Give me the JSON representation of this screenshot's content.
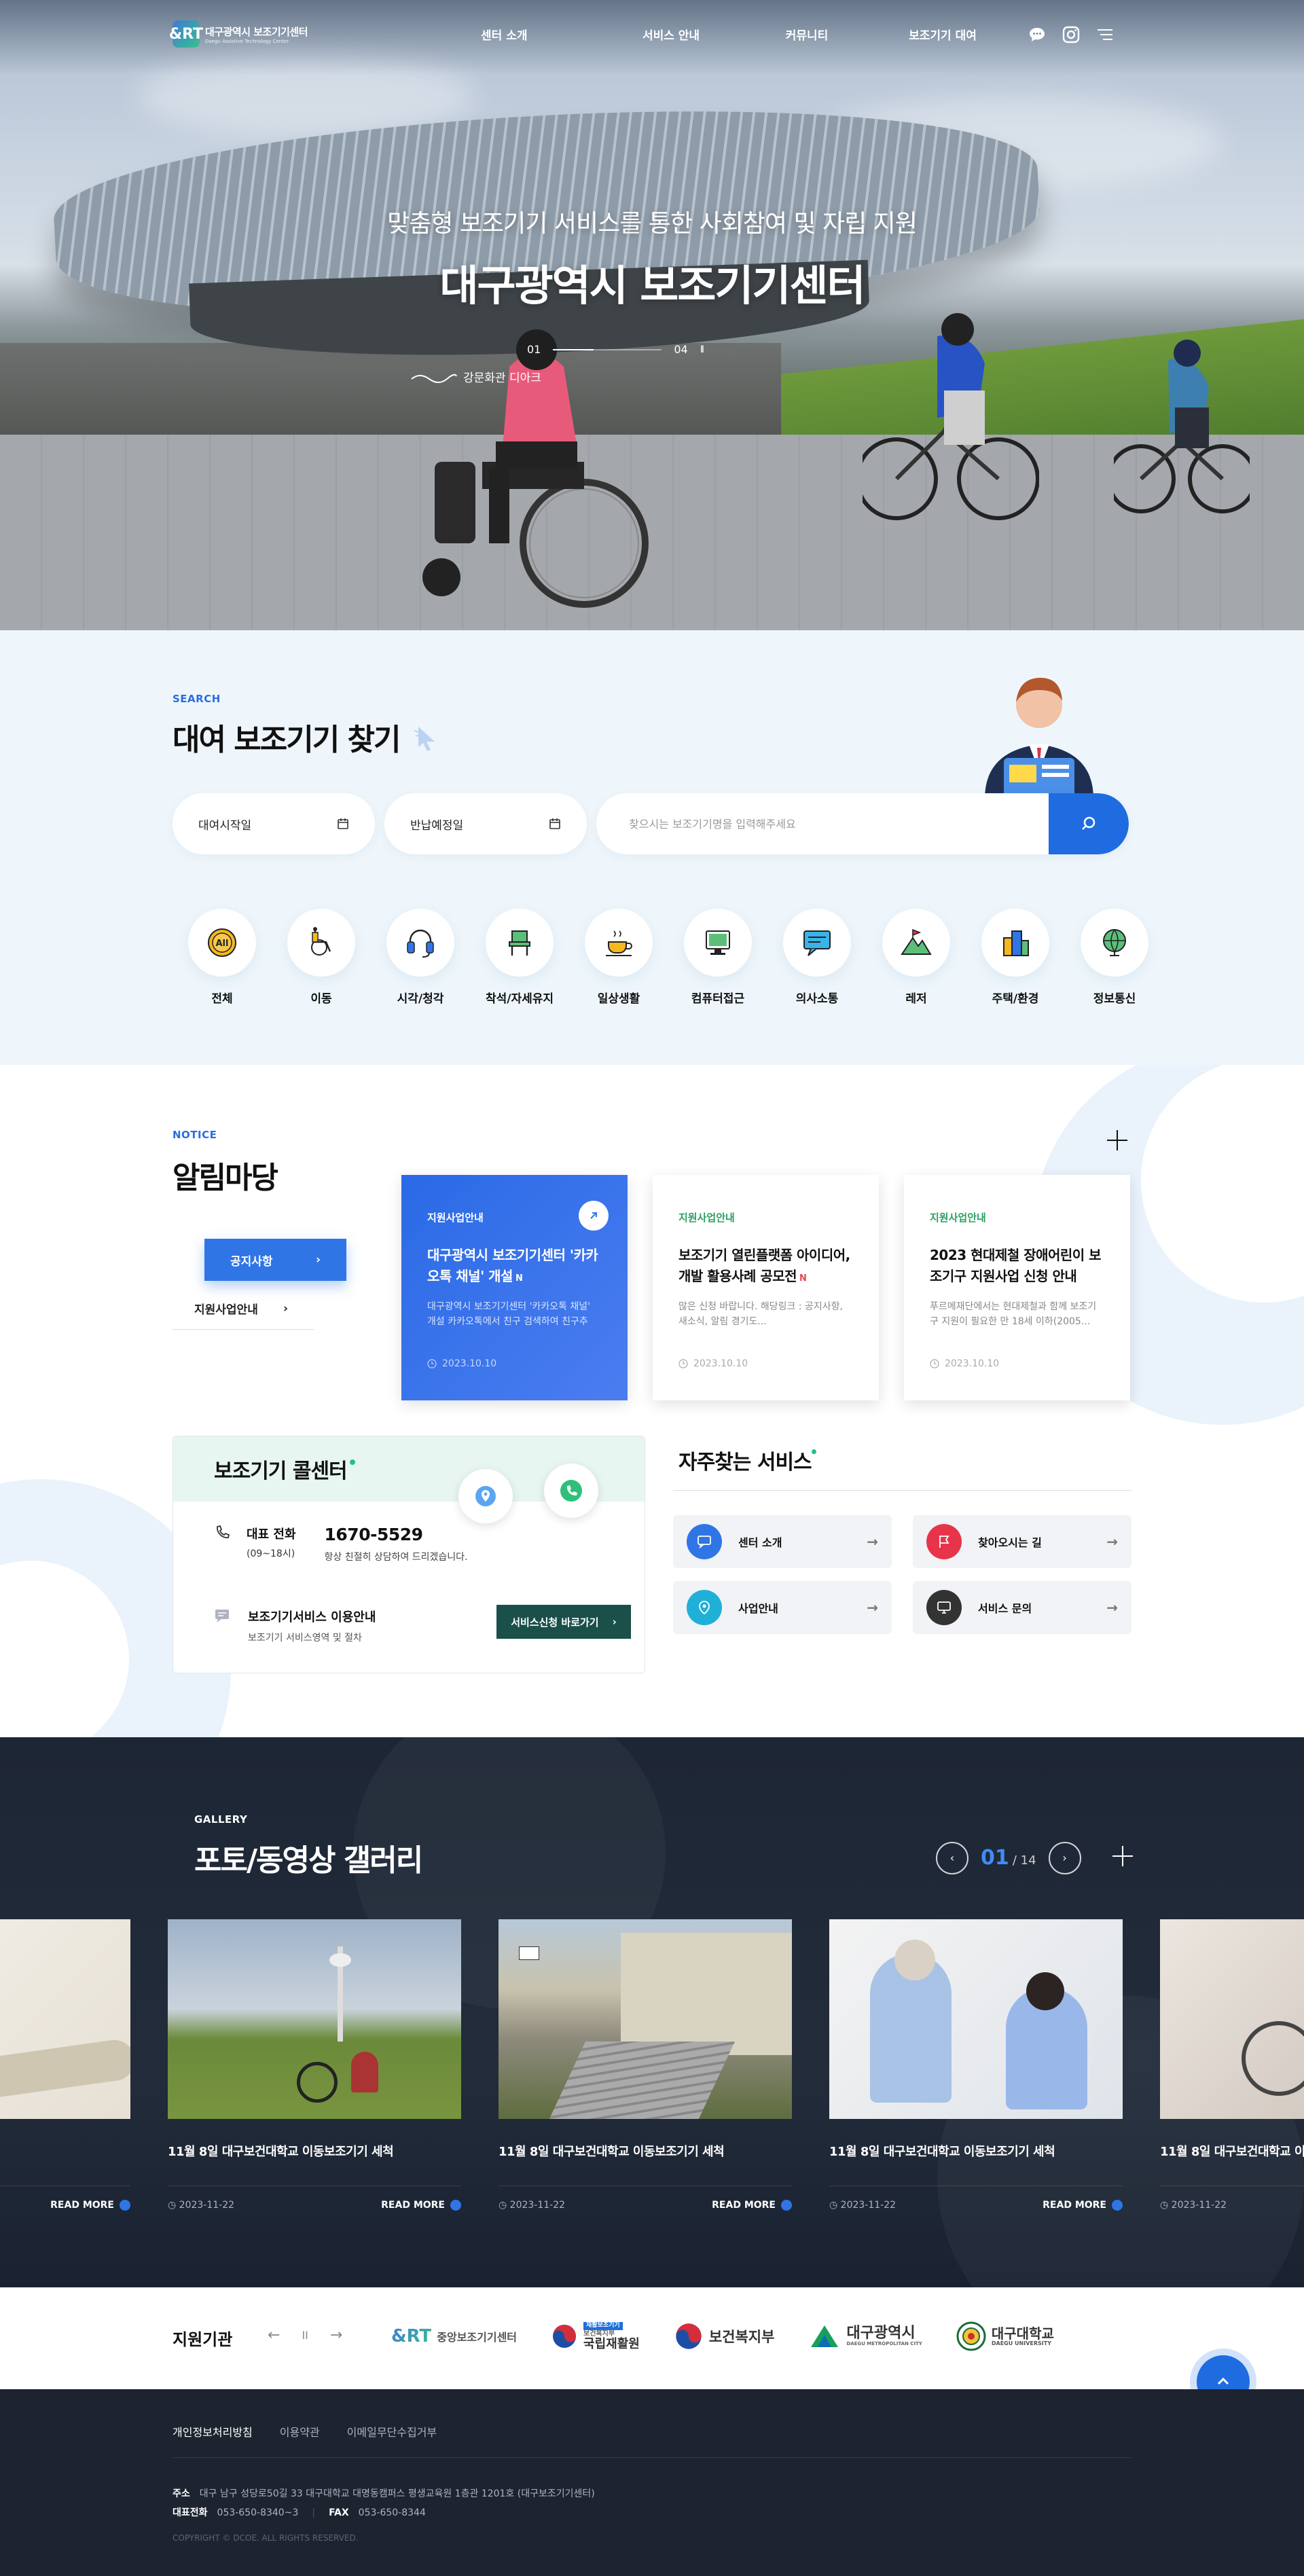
{
  "header": {
    "logo_mark": "&RT",
    "logo_ko": "대구광역시 보조기기센터",
    "logo_en": "Daegu Assistive Technology Center",
    "nav": [
      "센터 소개",
      "서비스 안내",
      "커뮤니티",
      "보조기기 대여"
    ],
    "icons": [
      "chat-icon",
      "instagram-icon",
      "menu-icon"
    ]
  },
  "hero": {
    "subtitle": "맞춤형 보조기기 서비스를 통한 사회참여 및 자립 지원",
    "title": "대구광역시 보조기기센터",
    "slide_current": "01",
    "slide_total": "04",
    "pause_label": "II",
    "caption": "강문화관 디아크"
  },
  "search": {
    "eyebrow": "SEARCH",
    "title": "대여 보조기기 찾기",
    "start_date_label": "대여시작일",
    "end_date_label": "반납예정일",
    "placeholder": "찾으시는 보조기기명을 입력해주세요",
    "categories": [
      "전체",
      "이동",
      "시각/청각",
      "착석/자세유지",
      "일상생활",
      "컴퓨터접근",
      "의사소통",
      "레저",
      "주택/환경",
      "정보통신"
    ],
    "all_icon_text": "All"
  },
  "notice": {
    "eyebrow": "NOTICE",
    "title": "알림마당",
    "tabs": [
      "공지사항",
      "지원사업안내"
    ],
    "cards": [
      {
        "tag": "지원사업안내",
        "title": "대구광역시 보조기기센터 '카카오톡 채널' 개설",
        "new": "N",
        "desc": "대구광역시 보조기기센터 '카카오톡 채널' 개설 카카오톡에서 친구 검색하여 친구추가...",
        "date": "2023.10.10"
      },
      {
        "tag": "지원사업안내",
        "title": "보조기기 열린플랫폼 아이디어, 개발 활용사례 공모전",
        "new": "N",
        "desc": "많은 신청 바랍니다. 해당링크 : 공지사항, 새소식, 알림 경기도...",
        "date": "2023.10.10"
      },
      {
        "tag": "지원사업안내",
        "title": "2023 현대제철 장애어린이 보조기구 지원사업 신청 안내",
        "new": "",
        "desc": "푸르메재단에서는 현대제철과 함께 보조기구 지원이 필요한 만 18세 이하(2005...",
        "date": "2023.10.10"
      }
    ]
  },
  "call_center": {
    "title": "보조기기 콜센터",
    "phone_label": "대표 전화",
    "hours": "(09~18시)",
    "phone": "1670-5529",
    "phone_note": "항상 친절히 상담하여 드리겠습니다.",
    "guide_label": "보조기기서비스 이용안내",
    "guide_sub": "보조기기 서비스영역 및 절차",
    "guide_button": "서비스신청 바로가기"
  },
  "favorites": {
    "title": "자주찾는 서비스",
    "items": [
      {
        "label": "센터 소개",
        "icon": "chat-icon",
        "color": "#2f75e6"
      },
      {
        "label": "찾아오시는 길",
        "icon": "flag-icon",
        "color": "#e8344a"
      },
      {
        "label": "사업안내",
        "icon": "pin-icon",
        "color": "#1fb0d8"
      },
      {
        "label": "서비스 문의",
        "icon": "monitor-icon",
        "color": "#333333"
      }
    ]
  },
  "gallery": {
    "eyebrow": "GALLERY",
    "title": "포토/동영상 갤러리",
    "current": "01",
    "total": "/ 14",
    "items": [
      {
        "caption": "",
        "date": "",
        "read_more": "READ MORE"
      },
      {
        "caption": "11월 8일 대구보건대학교 이동보조기기 세척",
        "date": "2023-11-22",
        "read_more": "READ MORE"
      },
      {
        "caption": "11월 8일 대구보건대학교 이동보조기기 세척",
        "date": "2023-11-22",
        "read_more": "READ MORE"
      },
      {
        "caption": "11월 8일 대구보건대학교 이동보조기기 세척",
        "date": "2023-11-22",
        "read_more": "READ MORE"
      },
      {
        "caption": "11월 8일 대구보건대학교 이동보조기기 세척",
        "date": "2023-11-22",
        "read_more": ""
      }
    ]
  },
  "partners": {
    "title": "지원기관",
    "logos": [
      "중앙보조기기센터",
      "국립재활원",
      "보건복지부",
      "대구광역시",
      "대구대학교"
    ],
    "logo_subs": [
      "",
      "보건복지부",
      "",
      "DAEGU METROPOLITAN CITY",
      "DAEGU UNIVERSITY"
    ],
    "rehab_badge": "재활보조기기"
  },
  "footer": {
    "links": [
      "개인정보처리방침",
      "이용약관",
      "이메일무단수집거부"
    ],
    "address_label": "주소",
    "address": "대구 남구 성당로50길 33 대구대학교 대명동캠퍼스 평생교육원 1층관 1201호 (대구보조기기센터)",
    "phone_label": "대표전화",
    "phone": "053-650-8340~3",
    "fax_label": "FAX",
    "fax": "053-650-8344",
    "copyright": "COPYRIGHT © DCOE. ALL RIGHTS RESERVED."
  },
  "colors": {
    "primary": "#1e6ce0",
    "accent_green": "#22c08a",
    "dark": "#1d2430"
  }
}
